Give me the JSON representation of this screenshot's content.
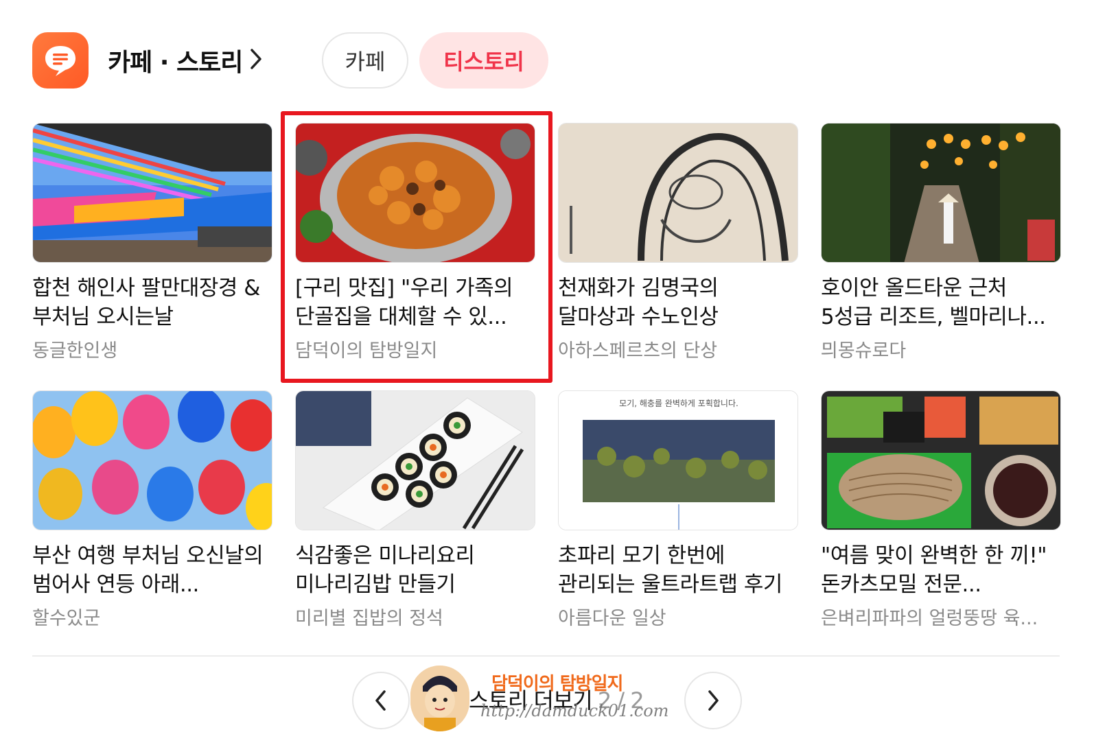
{
  "header": {
    "title": "카페 · 스토리",
    "tabs": [
      {
        "label": "카페",
        "active": false
      },
      {
        "label": "티스토리",
        "active": true
      }
    ]
  },
  "cards": [
    {
      "title": "합천 해인사 팔만대장경 & 부처님 오시는날",
      "source": "동글한인생",
      "thumb": "temple-lanterns"
    },
    {
      "title": "[구리 맛집] \"우리 가족의 단골집을 대체할 수 있...",
      "source": "담덕이의 탐방일지",
      "thumb": "spicy-stir-fry",
      "highlighted": true
    },
    {
      "title": "천재화가 김명국의 달마상과 수노인상",
      "source": "아하스페르츠의 단상",
      "thumb": "dharma-painting"
    },
    {
      "title": "호이안 올드타운 근처 5성급 리조트, 벨마리나...",
      "source": "믜몽슈로다",
      "thumb": "resort-lanterns"
    },
    {
      "title": "부산 여행 부처님 오신날의 범어사 연등 아래...",
      "source": "할수있군",
      "thumb": "colorful-lanterns"
    },
    {
      "title": "식감좋은 미나리요리 미나리김밥 만들기",
      "source": "미리별 집밥의 정석",
      "thumb": "kimbap"
    },
    {
      "title": "초파리 모기 한번에 관리되는 울트라트랩 후기",
      "source": "아름다운 일상",
      "thumb": "insect-trap",
      "thumb_caption": "모기, 해충를 완벽하게 포획합니다."
    },
    {
      "title": "\"여름 맞이 완벽한 한 끼!\" 돈카츠모밀 전문...",
      "source": "은벼리파파의 얼렁뚱땅 육...",
      "thumb": "tonkatsu-soba"
    }
  ],
  "footer": {
    "more_label": "스토리 더보기",
    "page_current": "2",
    "page_total": "2",
    "page_text": "2 / 2",
    "prev_icon": "chevron-left-icon",
    "next_icon": "chevron-right-icon"
  },
  "watermark": {
    "name": "담덕이의 탐방일지",
    "url": "http://damduck01.com"
  },
  "colors": {
    "accent": "#f0344a",
    "accent_bg": "#ffe4e4",
    "logo": "#ff6430",
    "highlight_box": "#e8171f",
    "source_text": "#8a8a8a"
  }
}
